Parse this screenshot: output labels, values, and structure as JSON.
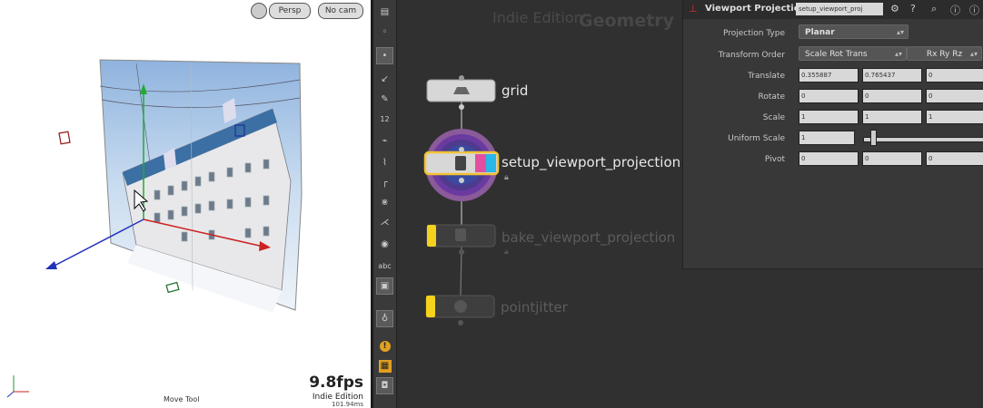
{
  "viewport": {
    "buttons": [
      {
        "label": "Persp"
      },
      {
        "label": "No cam"
      }
    ],
    "fps": "9.8fps",
    "edition": "Indie Edition",
    "subtimer": "101.94ms",
    "tool": "Move Tool"
  },
  "toolbar": {
    "items": [
      {
        "icon": "select-icon"
      },
      {
        "icon": "arrow-icon"
      },
      {
        "icon": "brush-icon"
      },
      {
        "icon": "number-icon",
        "text": "12"
      },
      {
        "icon": "paint-icon"
      },
      {
        "icon": "corner-icon"
      },
      {
        "icon": "snap-icon"
      },
      {
        "icon": "split-icon"
      },
      {
        "icon": "circle-icon"
      },
      {
        "icon": "text-icon",
        "text": "abc"
      },
      {
        "icon": "image-icon"
      },
      {
        "icon": "lightbulb-icon"
      },
      {
        "icon": "warning-icon",
        "text": "!"
      },
      {
        "icon": "grid-icon"
      },
      {
        "icon": "display-icon"
      }
    ]
  },
  "network": {
    "edition": "Indie Edition",
    "context": "Geometry",
    "nodes": [
      {
        "name": "grid"
      },
      {
        "name": "setup_viewport_projection"
      },
      {
        "name": "bake_viewport_projection"
      },
      {
        "name": "pointjitter"
      }
    ]
  },
  "params": {
    "title": "Viewport Projection",
    "node_name": "setup_viewport_proj",
    "rows": [
      {
        "label": "Projection Type"
      },
      {
        "label": "Transform Order"
      },
      {
        "label": "Translate"
      },
      {
        "label": "Rotate"
      },
      {
        "label": "Scale"
      },
      {
        "label": "Uniform Scale"
      },
      {
        "label": "Pivot"
      }
    ],
    "projection_type": "Planar",
    "transform_order": "Scale Rot Trans",
    "rotate_order": "Rx Ry Rz",
    "translate": [
      "0.355887",
      "0.765437",
      "0"
    ],
    "rotate": [
      "0",
      "0",
      "0"
    ],
    "scale": [
      "1",
      "1",
      "1"
    ],
    "uniform_scale": "1",
    "pivot": [
      "0",
      "0",
      "0"
    ]
  },
  "colors": {
    "selection": "#f1c232",
    "node_cyan": "#29b6e8",
    "node_magenta": "#e24fa0",
    "node_yellow": "#f5d21c",
    "axis_red": "#cc2222",
    "axis_green": "#22aa33",
    "axis_blue": "#2233bb"
  }
}
